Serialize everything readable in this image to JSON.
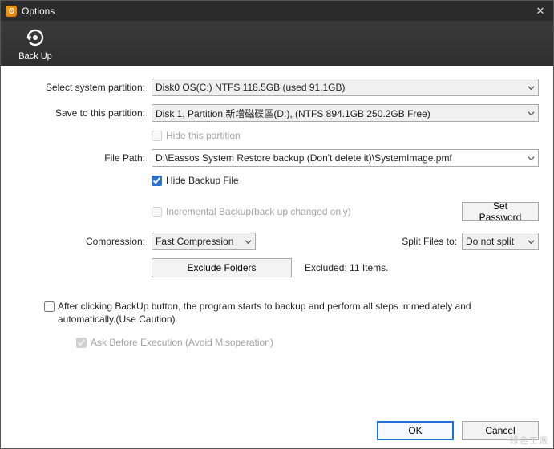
{
  "window": {
    "title": "Options"
  },
  "tab": {
    "backup_label": "Back Up"
  },
  "labels": {
    "select_partition": "Select system partition:",
    "save_to": "Save to this partition:",
    "file_path": "File Path:",
    "compression": "Compression:",
    "split_files": "Split Files to:",
    "excluded_prefix": "Excluded: ",
    "excluded_count": "11 Items."
  },
  "combos": {
    "system_partition": "Disk0  OS(C:) NTFS 118.5GB (used 91.1GB)",
    "save_partition": "Disk 1, Partition 新增磁碟區(D:), (NTFS 894.1GB 250.2GB Free)",
    "file_path": "D:\\Eassos System Restore backup (Don't delete it)\\SystemImage.pmf",
    "compression_value": "Fast Compression",
    "split_value": "Do not split"
  },
  "checkboxes": {
    "hide_partition": "Hide this partition",
    "hide_backup_file": "Hide Backup File",
    "incremental": "Incremental Backup(back up changed only)",
    "auto_text": "After clicking BackUp button, the program starts to backup and perform all steps immediately and automatically.(Use Caution)",
    "ask_before": "Ask Before Execution (Avoid Misoperation)"
  },
  "buttons": {
    "set_password": "Set Password",
    "exclude_folders": "Exclude Folders",
    "ok": "OK",
    "cancel": "Cancel"
  },
  "watermark": "綠色工廠"
}
